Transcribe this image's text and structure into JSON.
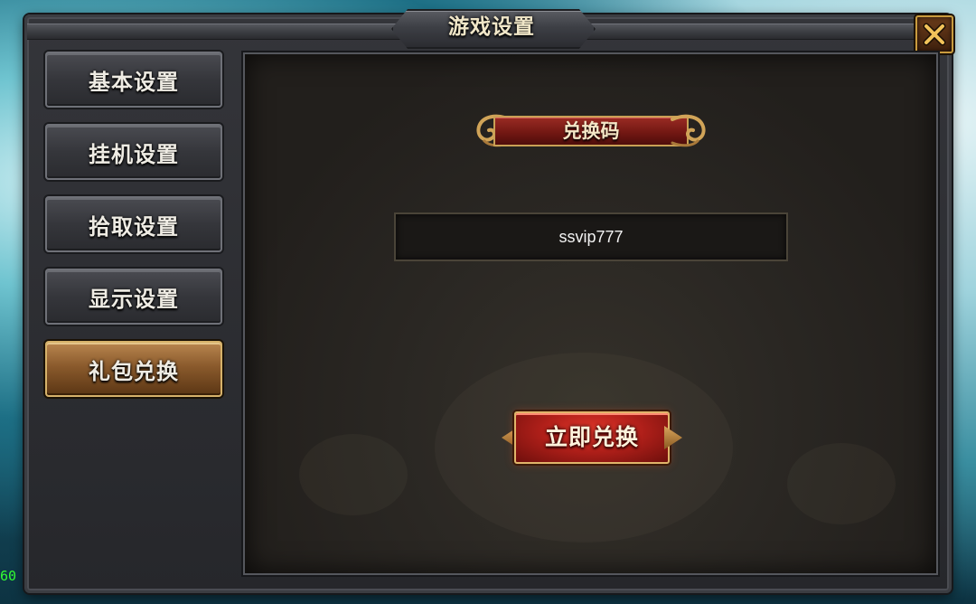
{
  "window": {
    "title": "游戏设置"
  },
  "sidebar": {
    "items": [
      {
        "label": "基本设置",
        "active": false
      },
      {
        "label": "挂机设置",
        "active": false
      },
      {
        "label": "拾取设置",
        "active": false
      },
      {
        "label": "显示设置",
        "active": false
      },
      {
        "label": "礼包兑换",
        "active": true
      }
    ]
  },
  "content": {
    "banner_label": "兑换码",
    "code_input": {
      "value": "ssvip777",
      "placeholder": ""
    },
    "redeem_label": "立即兑换"
  },
  "hud": {
    "fps": "60"
  },
  "icons": {
    "close": "close-icon"
  },
  "colors": {
    "accent_gold": "#c99b3e",
    "banner_red": "#8a2219",
    "redeem_red": "#c52a1f",
    "active_tab": "#a87340"
  }
}
